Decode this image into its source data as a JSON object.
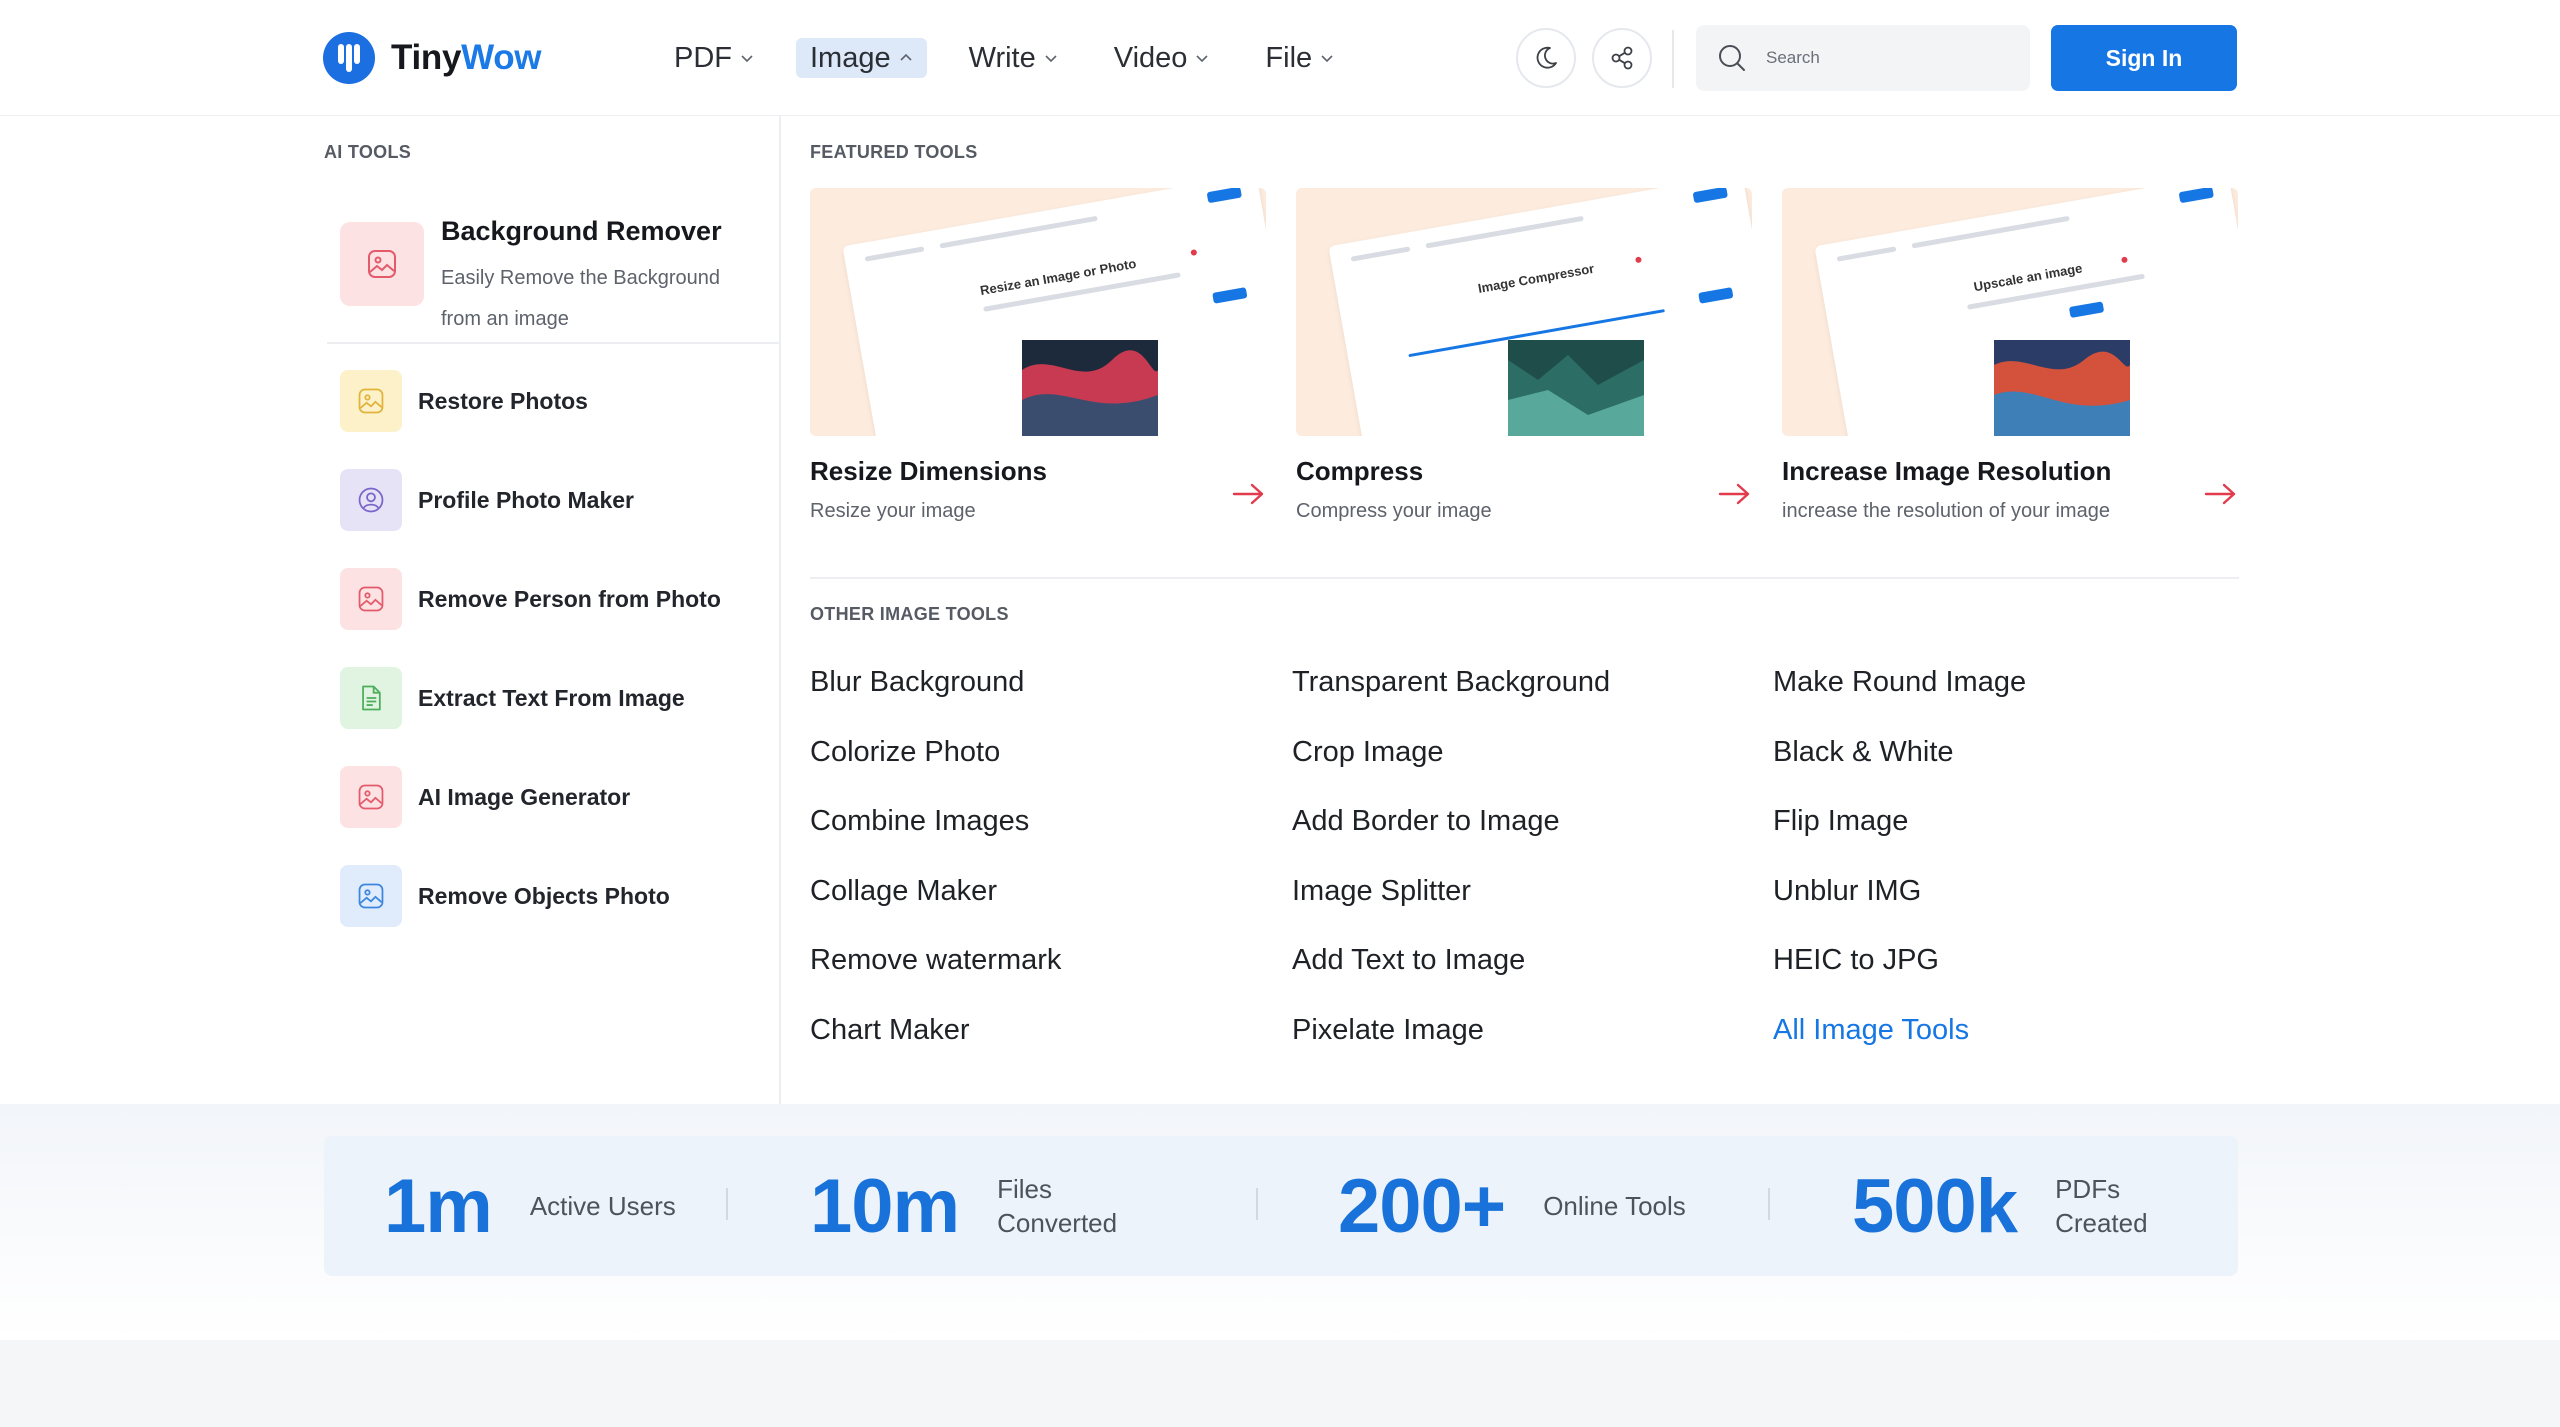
{
  "header": {
    "logo_part1": "Tiny",
    "logo_part2": "Wow",
    "nav": [
      {
        "label": "PDF",
        "active": false
      },
      {
        "label": "Image",
        "active": true
      },
      {
        "label": "Write",
        "active": false
      },
      {
        "label": "Video",
        "active": false
      },
      {
        "label": "File",
        "active": false
      }
    ],
    "search_placeholder": "Search",
    "signin_label": "Sign In"
  },
  "ai_tools": {
    "section_label": "AI TOOLS",
    "featured": {
      "title": "Background Remover",
      "description": "Easily Remove the Background from an image"
    },
    "items": [
      {
        "label": "Restore Photos",
        "icon": "image-icon",
        "color": "#fdf1c9"
      },
      {
        "label": "Profile Photo Maker",
        "icon": "user-circle-icon",
        "color": "#e6e3f7"
      },
      {
        "label": "Remove Person from Photo",
        "icon": "image-icon",
        "color": "#fde2e4"
      },
      {
        "label": "Extract Text From Image",
        "icon": "document-icon",
        "color": "#e0f4e1"
      },
      {
        "label": "AI Image Generator",
        "icon": "image-icon",
        "color": "#fde2e4"
      },
      {
        "label": "Remove Objects Photo",
        "icon": "image-icon",
        "color": "#e0ecfb"
      }
    ]
  },
  "featured_tools": {
    "section_label": "FEATURED TOOLS",
    "cards": [
      {
        "title": "Resize Dimensions",
        "description": "Resize your image",
        "thumb_headline": "Resize an Image or Photo"
      },
      {
        "title": "Compress",
        "description": "Compress your image",
        "thumb_headline": "Image Compressor"
      },
      {
        "title": "Increase Image Resolution",
        "description": "increase the resolution of your image",
        "thumb_headline": "Upscale an image"
      }
    ]
  },
  "other_tools": {
    "section_label": "OTHER IMAGE TOOLS",
    "columns": [
      [
        "Blur Background",
        "Colorize Photo",
        "Combine Images",
        "Collage Maker",
        "Remove watermark",
        "Chart Maker"
      ],
      [
        "Transparent Background",
        "Crop Image",
        "Add Border to Image",
        "Image Splitter",
        "Add Text to Image",
        "Pixelate Image"
      ],
      [
        "Make Round Image",
        "Black & White",
        "Flip Image",
        "Unblur IMG",
        "HEIC to JPG",
        "All Image Tools"
      ]
    ]
  },
  "stats": [
    {
      "value": "1m",
      "label": "Active Users"
    },
    {
      "value": "10m",
      "label": "Files Converted"
    },
    {
      "value": "200+",
      "label": "Online Tools"
    },
    {
      "value": "500k",
      "label": "PDFs Created"
    }
  ],
  "colors": {
    "brand_blue": "#1677e4",
    "accent_red": "#e23b4e",
    "stat_blue": "#1872d9"
  }
}
